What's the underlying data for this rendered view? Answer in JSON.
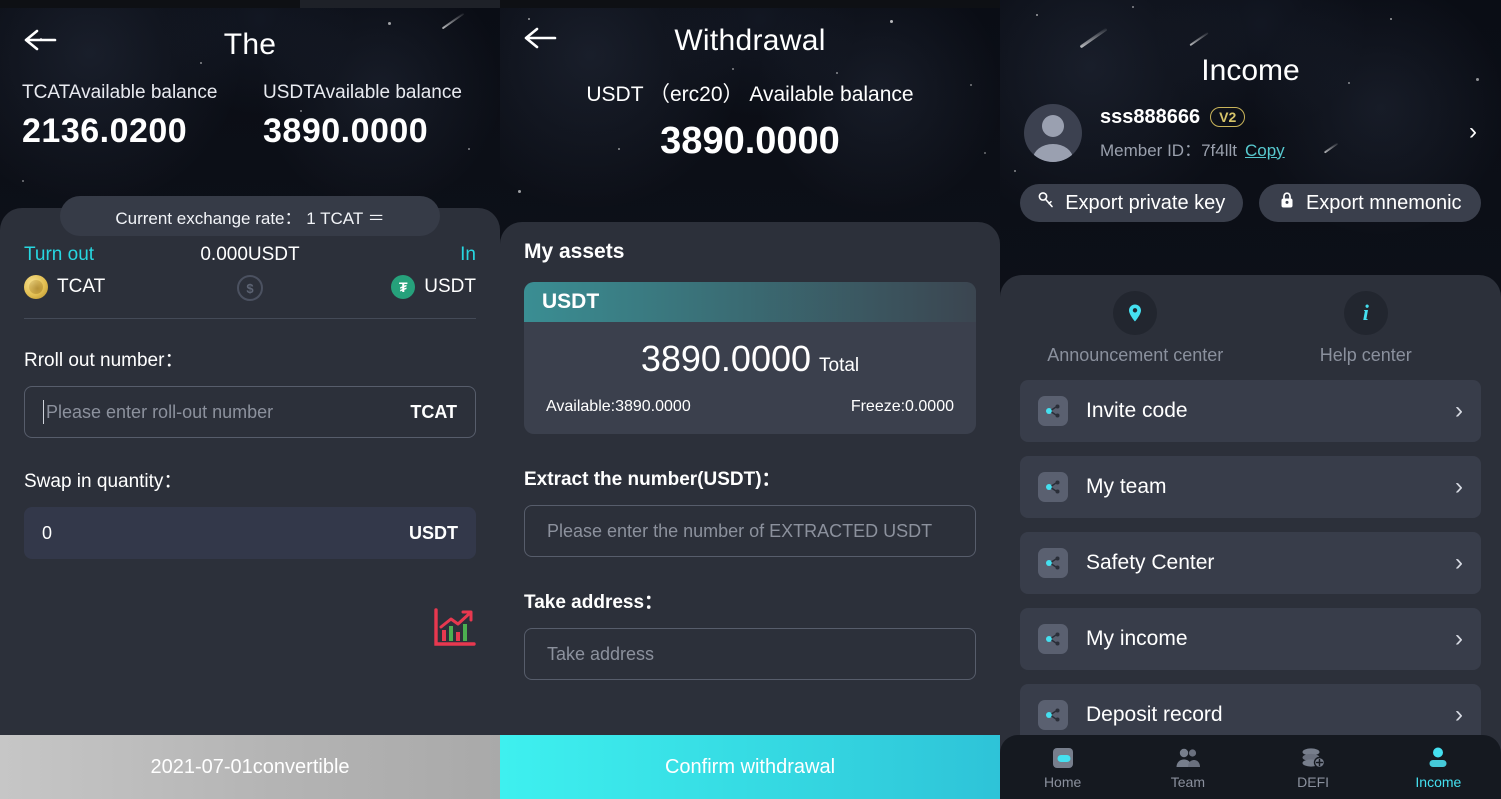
{
  "panel1": {
    "title": "The",
    "back_icon": "back-arrow-icon",
    "balances": [
      {
        "label": "TCATAvailable balance",
        "value": "2136.0200"
      },
      {
        "label": "USDTAvailable balance",
        "value": "3890.0000"
      }
    ],
    "exchange_rate": "Current exchange rate： 1 TCAT ＝",
    "swap": {
      "from_kicker": "Turn out",
      "from_coin": "TCAT",
      "mid_amount": "0.000USDT",
      "to_kicker": "In",
      "to_coin": "USDT",
      "swap_icon": "swap-circle-icon"
    },
    "roll_out_label": "Rroll out number：",
    "roll_out_placeholder": "Please enter roll-out number",
    "roll_out_suffix": "TCAT",
    "swap_in_label": "Swap in quantity：",
    "swap_in_value": "0",
    "swap_in_suffix": "USDT",
    "chart_icon": "chart-trend-icon",
    "bottom_button": "2021-07-01convertible"
  },
  "panel2": {
    "title": "Withdrawal",
    "back_icon": "back-arrow-icon",
    "subtitle": "USDT （erc20） Available balance",
    "balance": "3890.0000",
    "my_assets_label": "My assets",
    "asset": {
      "symbol": "USDT",
      "total_value": "3890.0000",
      "total_label": "Total",
      "available": "Available:3890.0000",
      "freeze": "Freeze:0.0000"
    },
    "extract_label": "Extract the number(USDT)：",
    "extract_placeholder": "Please enter the number of EXTRACTED USDT",
    "address_label": "Take address：",
    "address_placeholder": "Take address",
    "bottom_button": "Confirm withdrawal"
  },
  "panel3": {
    "title": "Income",
    "profile": {
      "avatar_icon": "avatar-icon",
      "name": "sss888666",
      "level_badge": "V2",
      "member_id_label": "Member ID：",
      "member_id": "7f4llt",
      "copy_label": "Copy",
      "chevron_icon": "chevron-right-icon"
    },
    "export_buttons": [
      {
        "label": "Export private key",
        "icon": "key-icon"
      },
      {
        "label": "Export mnemonic",
        "icon": "lock-icon"
      }
    ],
    "centers": [
      {
        "label": "Announcement center",
        "icon": "location-pin-icon"
      },
      {
        "label": "Help center",
        "icon": "info-icon"
      }
    ],
    "menu": [
      {
        "label": "Invite code",
        "icon": "share-node-icon"
      },
      {
        "label": "My team",
        "icon": "share-node-icon"
      },
      {
        "label": "Safety Center",
        "icon": "share-node-icon"
      },
      {
        "label": "My income",
        "icon": "share-node-icon"
      },
      {
        "label": "Deposit record",
        "icon": "share-node-icon"
      }
    ],
    "tabs": [
      {
        "label": "Home",
        "icon": "home-icon",
        "active": false
      },
      {
        "label": "Team",
        "icon": "team-icon",
        "active": false
      },
      {
        "label": "DEFI",
        "icon": "defi-coins-icon",
        "active": false
      },
      {
        "label": "Income",
        "icon": "person-icon",
        "active": true
      }
    ]
  },
  "colors": {
    "accent_cyan": "#45e0f0",
    "card_bg": "#2c303a",
    "usdt_green": "#26a17b",
    "badge_gold": "#d7c46a",
    "chart_red": "#e8384f"
  }
}
